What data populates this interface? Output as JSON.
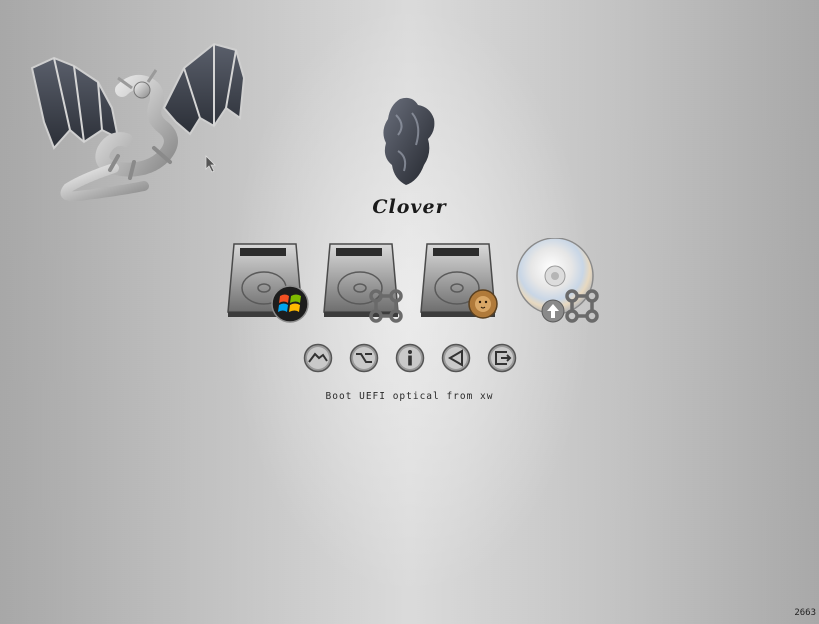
{
  "boot_menu": {
    "title": "Clover",
    "status_message": "Boot UEFI optical from xw",
    "revision": "2663",
    "boot_entries": [
      {
        "kind": "hard-drive",
        "os_badge": "windows-logo-icon"
      },
      {
        "kind": "hard-drive",
        "os_badge": "command-key-icon"
      },
      {
        "kind": "hard-drive",
        "os_badge": "lion-icon"
      },
      {
        "kind": "optical-disc",
        "os_badge": "command-key-icon",
        "extra_badge": "up-arrow-icon"
      }
    ],
    "tools": [
      "shell-icon",
      "options-icon",
      "info-icon",
      "back-icon",
      "exit-icon"
    ]
  },
  "colors": {
    "background_center": "#dedede",
    "background_edge": "#a9a9a9",
    "text": "#1a1a1a",
    "accent_dark": "#3a3e47"
  }
}
